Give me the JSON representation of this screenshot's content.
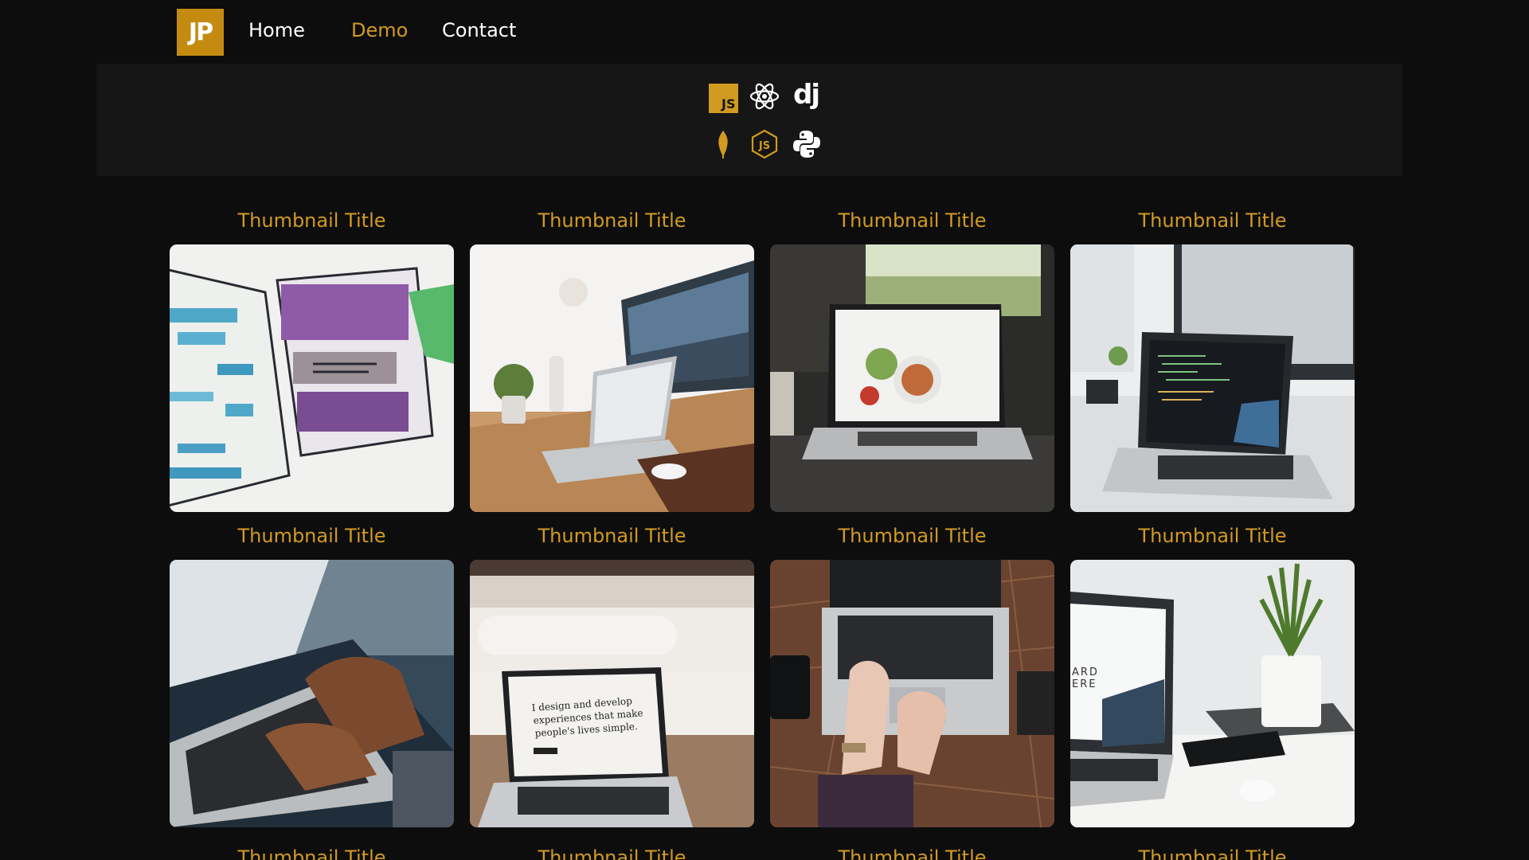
{
  "navbar": {
    "logo_text": "JP",
    "links": [
      {
        "label": "Home",
        "active": false
      },
      {
        "label": "Demo",
        "active": true
      },
      {
        "label": "Contact",
        "active": false
      }
    ]
  },
  "tech_banner": {
    "icons": [
      "javascript-icon",
      "react-icon",
      "django-icon",
      "mongodb-icon",
      "nodejs-icon",
      "python-icon"
    ],
    "js_label": "JS",
    "django_label": "dj"
  },
  "thumbnails": {
    "row1": [
      {
        "title": "Thumbnail Title",
        "image": "wireframe-sketch-image"
      },
      {
        "title": "Thumbnail Title",
        "image": "desk-laptop-imac-image"
      },
      {
        "title": "Thumbnail Title",
        "image": "laptop-food-site-image"
      },
      {
        "title": "Thumbnail Title",
        "image": "laptop-code-editor-image"
      }
    ],
    "row2": [
      {
        "title": "Thumbnail Title",
        "image": "hands-typing-laptop-image"
      },
      {
        "title": "Thumbnail Title",
        "image": "cafe-laptop-image",
        "screen_text": [
          "I design and develop",
          "experiences that make",
          "people's lives simple."
        ]
      },
      {
        "title": "Thumbnail Title",
        "image": "topdown-laptop-hands-image"
      },
      {
        "title": "Thumbnail Title",
        "image": "laptop-plant-desk-image",
        "screen_text": [
          "ARD",
          "ERE"
        ]
      }
    ],
    "row3": [
      {
        "title": "Thumbnail Title"
      },
      {
        "title": "Thumbnail Title"
      },
      {
        "title": "Thumbnail Title"
      },
      {
        "title": "Thumbnail Title"
      }
    ]
  },
  "colors": {
    "background": "#0d0d0e",
    "banner": "#161617",
    "accent": "#d29a20",
    "logo_bg": "#c48b10",
    "text": "#ffffff"
  }
}
